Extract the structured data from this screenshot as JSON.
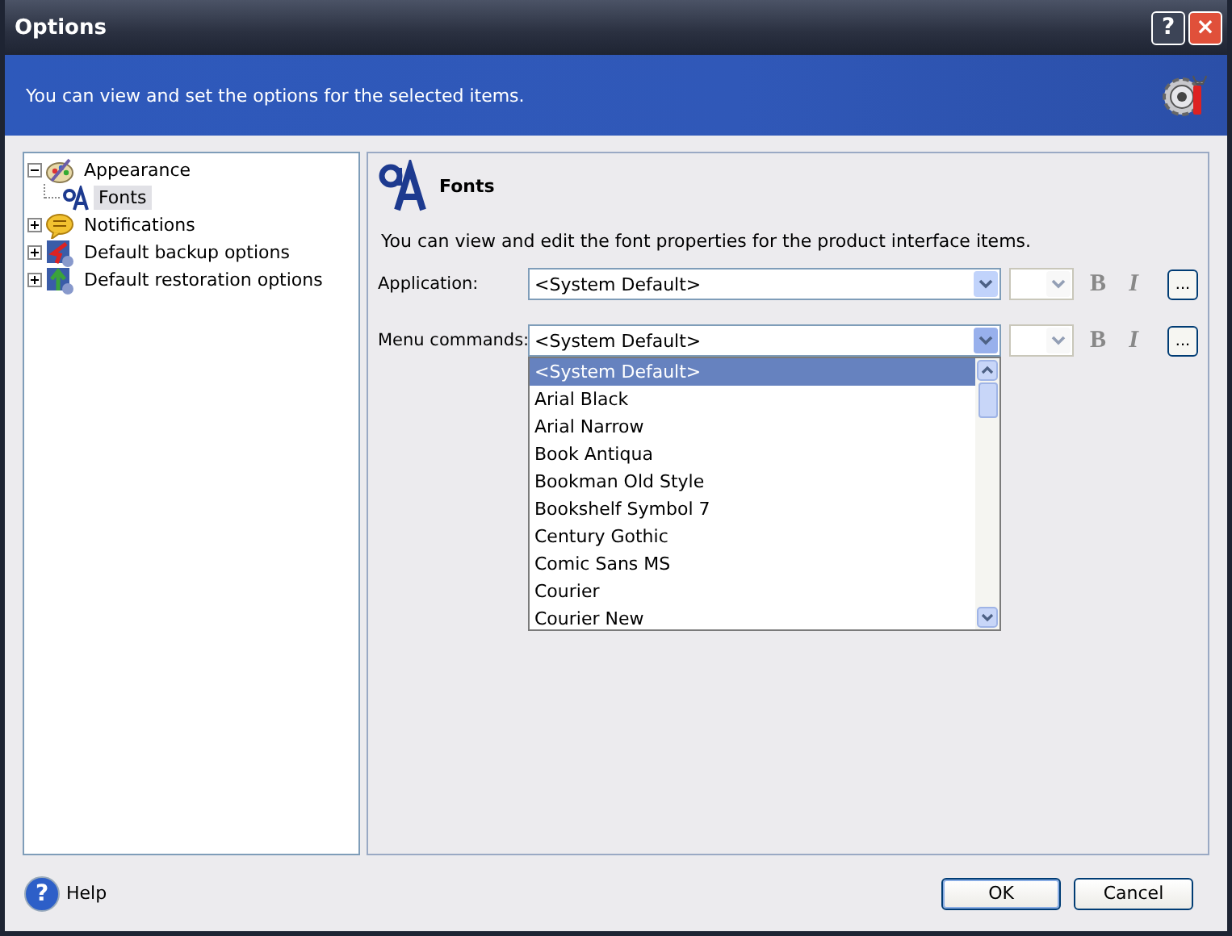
{
  "window": {
    "title": "Options",
    "help_button": "?",
    "close_button": "×"
  },
  "header": {
    "text": "You can view and set the options for the selected items."
  },
  "tree": [
    {
      "label": "Appearance",
      "expanded": true,
      "selected": false,
      "children": [
        {
          "label": "Fonts",
          "selected": true
        }
      ]
    },
    {
      "label": "Notifications",
      "expanded": false,
      "selected": false
    },
    {
      "label": "Default backup options",
      "expanded": false,
      "selected": false
    },
    {
      "label": "Default restoration options",
      "expanded": false,
      "selected": false
    }
  ],
  "panel": {
    "title": "Fonts",
    "description": "You can view and edit the font properties for the product interface items.",
    "rows": [
      {
        "label": "Application:",
        "value": "<System Default>",
        "open": false,
        "bold": "B",
        "italic": "I",
        "more": "..."
      },
      {
        "label": "Menu commands:",
        "value": "<System Default>",
        "open": true,
        "bold": "B",
        "italic": "I",
        "more": "..."
      }
    ],
    "dropdown_options": [
      {
        "label": "<System Default>",
        "selected": true
      },
      {
        "label": "Arial Black",
        "selected": false
      },
      {
        "label": "Arial Narrow",
        "selected": false
      },
      {
        "label": "Book Antiqua",
        "selected": false
      },
      {
        "label": "Bookman Old Style",
        "selected": false
      },
      {
        "label": "Bookshelf Symbol 7",
        "selected": false
      },
      {
        "label": "Century Gothic",
        "selected": false
      },
      {
        "label": "Comic Sans MS",
        "selected": false
      },
      {
        "label": "Courier",
        "selected": false
      },
      {
        "label": "Courier New",
        "selected": false
      }
    ]
  },
  "footer": {
    "help_icon": "?",
    "help": "Help",
    "buttons": [
      {
        "label": "OK",
        "default": true
      },
      {
        "label": "Cancel",
        "default": false
      }
    ]
  }
}
